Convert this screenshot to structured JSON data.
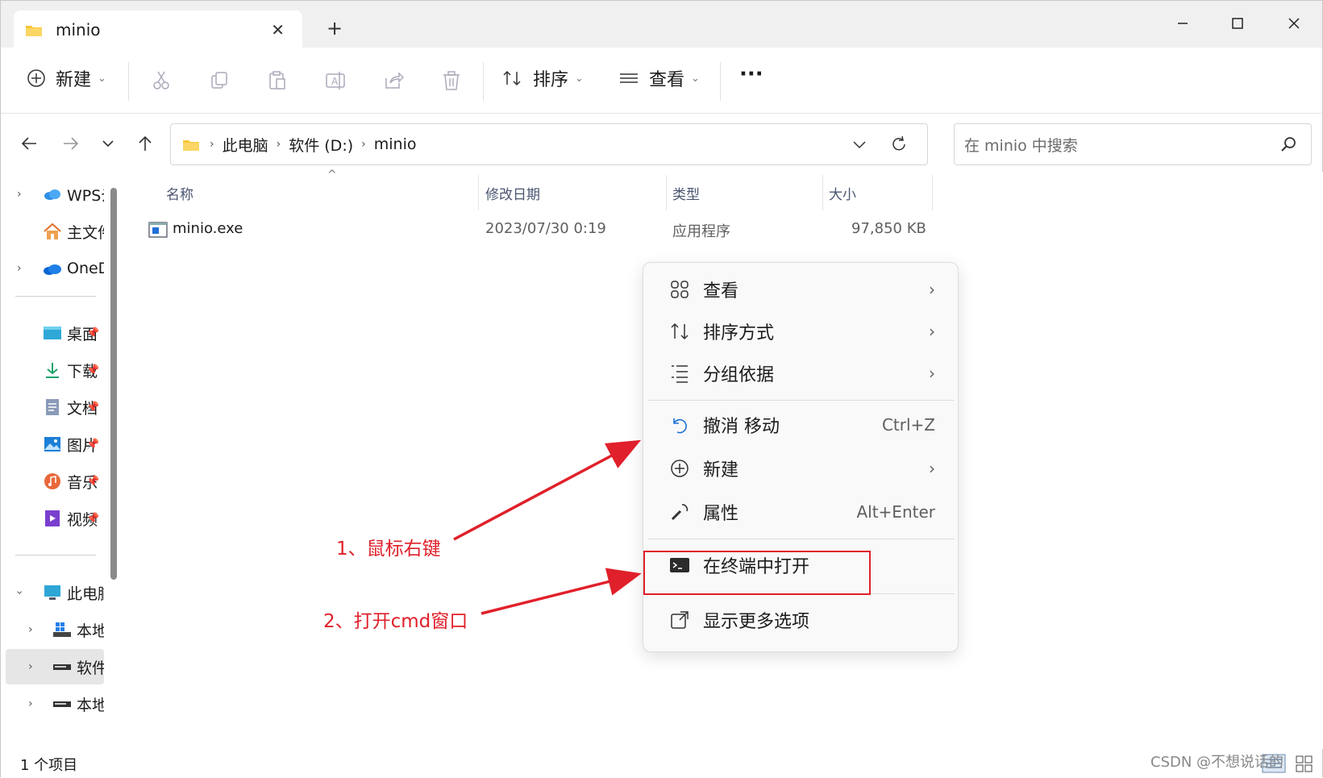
{
  "window": {
    "tab_title": "minio",
    "new_tab": "+"
  },
  "toolbar": {
    "new_label": "新建",
    "sort_label": "排序",
    "view_label": "查看",
    "more_label": "···"
  },
  "address": {
    "crumbs": [
      "此电脑",
      "软件 (D:)",
      "minio"
    ]
  },
  "search": {
    "placeholder": "在 minio 中搜索"
  },
  "sidebar": {
    "items": [
      {
        "label": "WPS云"
      },
      {
        "label": "主文件"
      },
      {
        "label": "OneD"
      },
      {
        "label": "桌面"
      },
      {
        "label": "下载"
      },
      {
        "label": "文档"
      },
      {
        "label": "图片"
      },
      {
        "label": "音乐"
      },
      {
        "label": "视频"
      },
      {
        "label": "此电脑"
      },
      {
        "label": "本地"
      },
      {
        "label": "软件"
      },
      {
        "label": "本地"
      }
    ]
  },
  "columns": {
    "name": "名称",
    "modified": "修改日期",
    "type": "类型",
    "size": "大小"
  },
  "files": [
    {
      "name": "minio.exe",
      "modified": "2023/07/30 0:19",
      "type": "应用程序",
      "size": "97,850 KB"
    }
  ],
  "context_menu": {
    "items": [
      {
        "label": "查看",
        "right": "›"
      },
      {
        "label": "排序方式",
        "right": "›"
      },
      {
        "label": "分组依据",
        "right": "›"
      },
      {
        "label": "撤消 移动",
        "right": "Ctrl+Z"
      },
      {
        "label": "新建",
        "right": "›"
      },
      {
        "label": "属性",
        "right": "Alt+Enter"
      },
      {
        "label": "在终端中打开",
        "right": ""
      },
      {
        "label": "显示更多选项",
        "right": ""
      }
    ]
  },
  "annotations": {
    "step1": "1、鼠标右键",
    "step2": "2、打开cmd窗口"
  },
  "status": {
    "count": "1 个项目"
  },
  "watermark": "CSDN @不想说话的"
}
